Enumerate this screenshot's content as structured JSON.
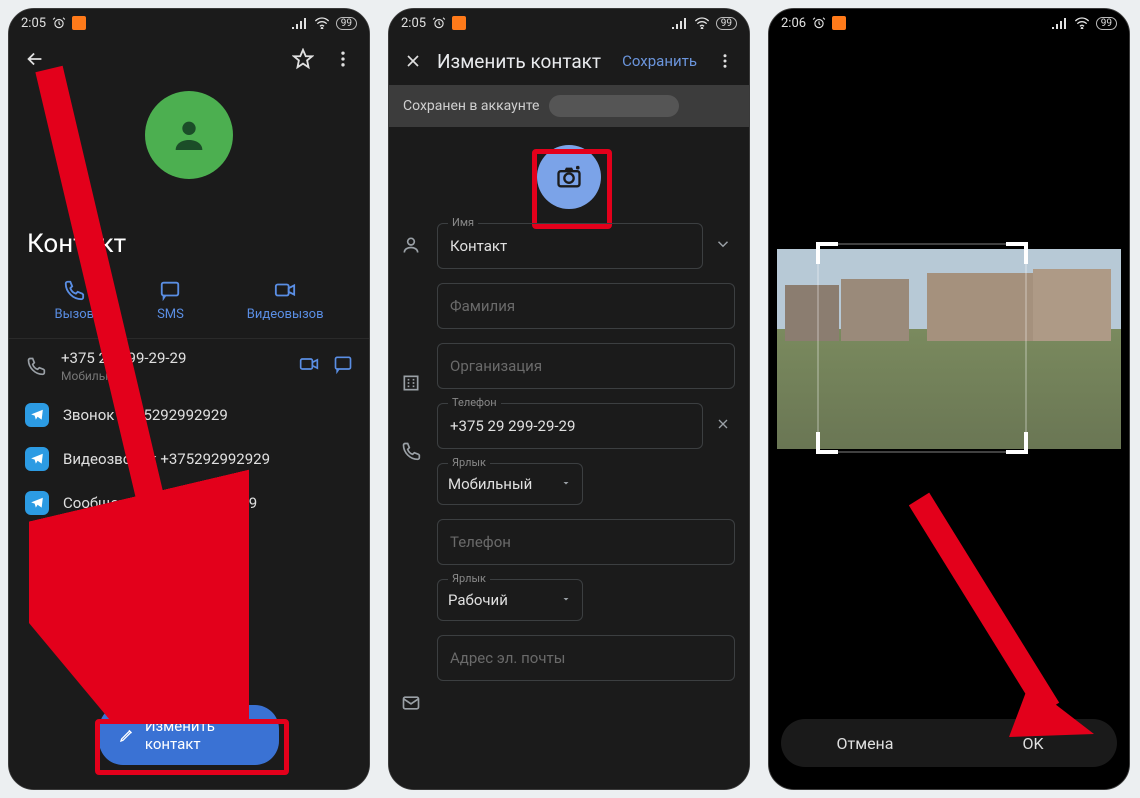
{
  "status": {
    "time1": "2:05",
    "time2": "2:05",
    "time3": "2:06",
    "battery": "99"
  },
  "screen1": {
    "contact_name": "Контакт",
    "actions": {
      "call": "Вызов",
      "sms": "SMS",
      "video": "Видеовызов"
    },
    "phone_row": {
      "number": "+375 29 299-29-29",
      "sub": "Мобильный"
    },
    "tg_call": "Звонок +375292992929",
    "tg_video": "Видеозвонок +375292992929",
    "tg_msg": "Сообщение +375292992929",
    "edit_btn": "Изменить контакт"
  },
  "screen2": {
    "title": "Изменить контакт",
    "save": "Сохранить",
    "account": "Сохранен в аккаунте",
    "labels": {
      "name": "Имя",
      "surname": "Фамилия",
      "org": "Организация",
      "phone": "Телефон",
      "label_field": "Ярлык",
      "phone2": "Телефон",
      "label2": "Ярлык",
      "email": "Адрес эл. почты"
    },
    "values": {
      "name": "Контакт",
      "phone": "+375 29 299-29-29",
      "mobile": "Мобильный",
      "work": "Рабочий"
    }
  },
  "screen3": {
    "cancel": "Отмена",
    "ok": "OK"
  },
  "colors": {
    "accent": "#3a72d4",
    "annotation": "#e3001b"
  }
}
